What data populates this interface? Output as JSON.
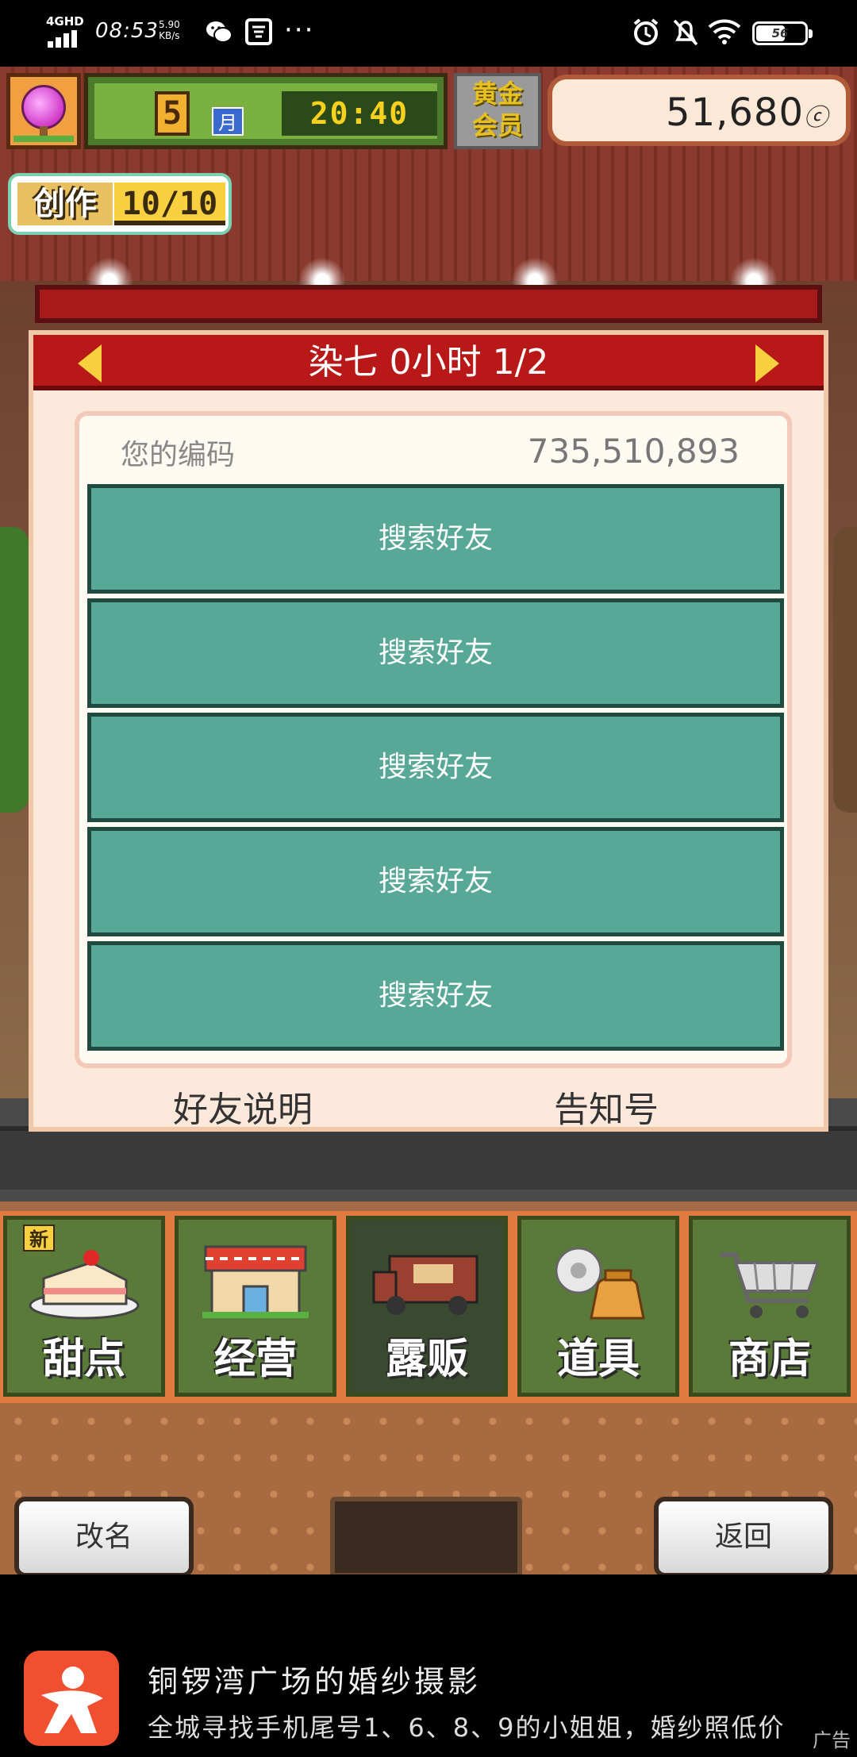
{
  "status_bar": {
    "network": "4GHD",
    "time": "08:53",
    "speed": "5.90",
    "speed_unit": "KB/s",
    "more": "···",
    "battery": "56"
  },
  "hud": {
    "month_number": "5",
    "month_unit": "月",
    "clock": "20:40",
    "member_line1": "黄金",
    "member_line2": "会员",
    "money": "51,680",
    "money_unit": "ⓒ",
    "create_label": "创作",
    "create_count": "10/10"
  },
  "dialog": {
    "title": "染七  0小时 1/2",
    "code_label": "您的编码",
    "code_value": "735,510,893",
    "friend_slots": [
      "搜索好友",
      "搜索好友",
      "搜索好友",
      "搜索好友",
      "搜索好友"
    ],
    "footer_left": "好友说明",
    "footer_right": "告知号"
  },
  "tabs": {
    "new_badge": "新",
    "items": [
      {
        "label": "甜点",
        "icon": "cake-icon"
      },
      {
        "label": "经营",
        "icon": "shop-building-icon"
      },
      {
        "label": "露贩",
        "icon": "food-truck-icon"
      },
      {
        "label": "道具",
        "icon": "gear-and-bag-icon"
      },
      {
        "label": "商店",
        "icon": "shopping-cart-icon"
      }
    ]
  },
  "bottom": {
    "rename_label": "改名",
    "back_label": "返回"
  },
  "ad": {
    "title": "铜锣湾广场的婚纱摄影",
    "desc": "全城寻找手机尾号1、6、8、9的小姐姐，婚纱照低价",
    "tag": "广告"
  },
  "colors": {
    "header_red": "#b81818",
    "friend_slot_teal": "#57a896",
    "tab_green": "#5a7a3a",
    "tab_active": "#3a4a30",
    "panel_cream": "#fffaf2",
    "money_bg": "#fce8d6"
  }
}
